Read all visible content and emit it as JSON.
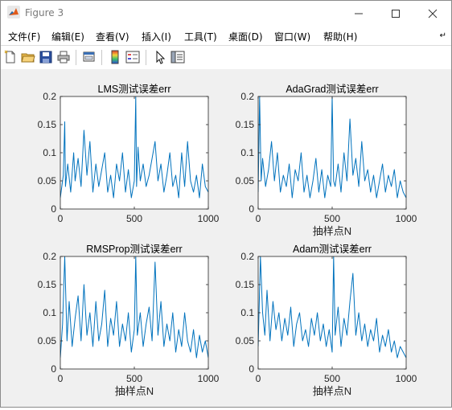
{
  "window": {
    "title": "Figure 3"
  },
  "menu": [
    "文件(F)",
    "编辑(E)",
    "查看(V)",
    "插入(I)",
    "工具(T)",
    "桌面(D)",
    "窗口(W)",
    "帮助(H)"
  ],
  "toolbar_icons": [
    "new-figure-icon",
    "open-file-icon",
    "save-icon",
    "print-icon",
    "link-plot-icon",
    "colorbar-icon",
    "legend-icon",
    "pointer-icon",
    "property-editor-icon"
  ],
  "colors": {
    "line": "#0072bd",
    "axes_bg": "#ffffff",
    "figure_bg": "#f0f0f0"
  },
  "chart_data": [
    {
      "type": "line",
      "title": "LMS测试误差err",
      "xlabel": "",
      "ylabel": "",
      "xlim": [
        0,
        1000
      ],
      "ylim": [
        0,
        0.2
      ],
      "xticks": [
        "0",
        "500",
        "1000"
      ],
      "yticks": [
        "0",
        "0.05",
        "0.1",
        "0.15",
        "0.2"
      ],
      "series": [
        {
          "color": "#0072bd",
          "x": [
            0,
            20,
            30,
            35,
            50,
            70,
            90,
            100,
            120,
            140,
            160,
            180,
            200,
            220,
            240,
            260,
            280,
            300,
            320,
            340,
            360,
            380,
            400,
            420,
            440,
            460,
            480,
            500,
            510,
            515,
            525,
            540,
            560,
            580,
            600,
            620,
            640,
            660,
            680,
            700,
            720,
            740,
            760,
            780,
            800,
            820,
            840,
            860,
            880,
            900,
            920,
            940,
            960,
            980,
            1000
          ],
          "y": [
            0.02,
            0.06,
            0.155,
            0.04,
            0.08,
            0.03,
            0.1,
            0.05,
            0.09,
            0.04,
            0.14,
            0.06,
            0.12,
            0.03,
            0.08,
            0.04,
            0.07,
            0.1,
            0.03,
            0.06,
            0.02,
            0.08,
            0.05,
            0.1,
            0.03,
            0.07,
            0.02,
            0.05,
            0.21,
            0.04,
            0.11,
            0.05,
            0.08,
            0.04,
            0.06,
            0.09,
            0.12,
            0.05,
            0.08,
            0.03,
            0.06,
            0.1,
            0.04,
            0.06,
            0.02,
            0.1,
            0.04,
            0.12,
            0.05,
            0.03,
            0.06,
            0.02,
            0.08,
            0.04,
            0.03
          ]
        }
      ]
    },
    {
      "type": "line",
      "title": "AdaGrad测试误差err",
      "xlabel": "抽样点N",
      "ylabel": "",
      "xlim": [
        0,
        1000
      ],
      "ylim": [
        0,
        0.2
      ],
      "xticks": [
        "0",
        "500",
        "1000"
      ],
      "yticks": [
        "0",
        "0.05",
        "0.1",
        "0.15",
        "0.2"
      ],
      "series": [
        {
          "color": "#0072bd",
          "x": [
            0,
            10,
            20,
            30,
            50,
            70,
            90,
            110,
            130,
            150,
            170,
            190,
            210,
            230,
            250,
            270,
            290,
            310,
            330,
            350,
            370,
            390,
            410,
            430,
            450,
            470,
            490,
            500,
            510,
            520,
            540,
            560,
            580,
            600,
            620,
            640,
            660,
            680,
            700,
            720,
            740,
            760,
            780,
            800,
            820,
            840,
            860,
            880,
            900,
            920,
            940,
            960,
            980,
            1000
          ],
          "y": [
            0.03,
            0.21,
            0.05,
            0.09,
            0.04,
            0.07,
            0.12,
            0.05,
            0.1,
            0.03,
            0.06,
            0.04,
            0.08,
            0.02,
            0.07,
            0.05,
            0.1,
            0.03,
            0.06,
            0.02,
            0.05,
            0.09,
            0.03,
            0.07,
            0.02,
            0.06,
            0.04,
            0.21,
            0.05,
            0.04,
            0.08,
            0.03,
            0.1,
            0.05,
            0.16,
            0.06,
            0.09,
            0.04,
            0.12,
            0.05,
            0.07,
            0.03,
            0.06,
            0.02,
            0.05,
            0.08,
            0.03,
            0.06,
            0.04,
            0.07,
            0.02,
            0.05,
            0.03,
            0.02
          ]
        }
      ]
    },
    {
      "type": "line",
      "title": "RMSProp测试误差err",
      "xlabel": "抽样点N",
      "ylabel": "",
      "xlim": [
        0,
        1000
      ],
      "ylim": [
        0,
        0.2
      ],
      "xticks": [
        "0",
        "500",
        "1000"
      ],
      "yticks": [
        "0",
        "0.05",
        "0.1",
        "0.15",
        "0.2"
      ],
      "series": [
        {
          "color": "#0072bd",
          "x": [
            0,
            15,
            30,
            45,
            60,
            80,
            100,
            120,
            140,
            160,
            180,
            200,
            220,
            240,
            260,
            280,
            300,
            320,
            340,
            360,
            380,
            400,
            420,
            440,
            460,
            480,
            500,
            510,
            520,
            540,
            560,
            580,
            600,
            620,
            640,
            660,
            680,
            700,
            720,
            740,
            760,
            780,
            800,
            820,
            840,
            860,
            880,
            900,
            920,
            940,
            960,
            980,
            1000
          ],
          "y": [
            0.02,
            0.08,
            0.21,
            0.05,
            0.12,
            0.04,
            0.09,
            0.13,
            0.05,
            0.15,
            0.06,
            0.1,
            0.04,
            0.12,
            0.05,
            0.08,
            0.14,
            0.04,
            0.09,
            0.06,
            0.12,
            0.04,
            0.08,
            0.05,
            0.1,
            0.03,
            0.07,
            0.21,
            0.06,
            0.1,
            0.04,
            0.08,
            0.11,
            0.05,
            0.19,
            0.06,
            0.12,
            0.04,
            0.08,
            0.05,
            0.1,
            0.03,
            0.07,
            0.04,
            0.1,
            0.05,
            0.03,
            0.07,
            0.02,
            0.06,
            0.03,
            0.05,
            0.02
          ]
        }
      ]
    },
    {
      "type": "line",
      "title": "Adam测试误差err",
      "xlabel": "抽样点N",
      "ylabel": "",
      "xlim": [
        0,
        1000
      ],
      "ylim": [
        0,
        0.2
      ],
      "xticks": [
        "0",
        "500",
        "1000"
      ],
      "yticks": [
        "0",
        "0.05",
        "0.1",
        "0.15",
        "0.2"
      ],
      "series": [
        {
          "color": "#0072bd",
          "x": [
            0,
            15,
            30,
            45,
            60,
            80,
            100,
            120,
            140,
            160,
            180,
            200,
            220,
            240,
            260,
            280,
            300,
            320,
            340,
            360,
            380,
            400,
            420,
            440,
            460,
            480,
            500,
            510,
            520,
            540,
            560,
            580,
            600,
            620,
            640,
            660,
            680,
            700,
            720,
            740,
            760,
            780,
            800,
            820,
            840,
            860,
            880,
            900,
            920,
            940,
            960,
            980,
            1000
          ],
          "y": [
            0.04,
            0.21,
            0.1,
            0.06,
            0.14,
            0.05,
            0.12,
            0.07,
            0.1,
            0.05,
            0.09,
            0.06,
            0.11,
            0.04,
            0.08,
            0.1,
            0.05,
            0.07,
            0.04,
            0.09,
            0.06,
            0.1,
            0.05,
            0.08,
            0.04,
            0.07,
            0.03,
            0.21,
            0.06,
            0.11,
            0.04,
            0.09,
            0.06,
            0.12,
            0.17,
            0.06,
            0.1,
            0.05,
            0.08,
            0.04,
            0.07,
            0.05,
            0.09,
            0.03,
            0.06,
            0.04,
            0.07,
            0.03,
            0.05,
            0.02,
            0.04,
            0.03,
            0.02
          ]
        }
      ]
    }
  ]
}
